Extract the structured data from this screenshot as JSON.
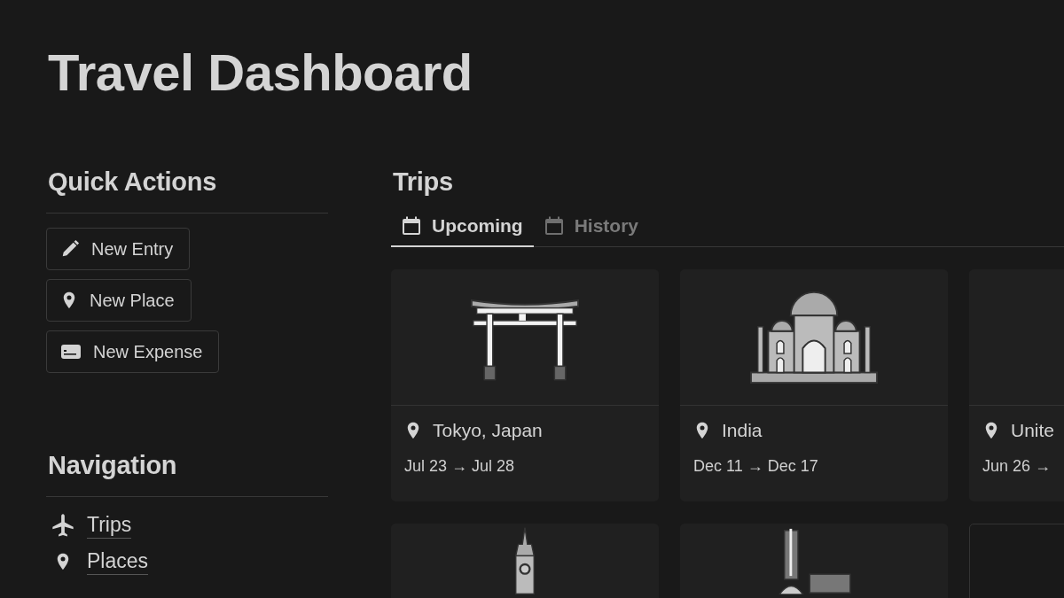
{
  "page": {
    "title": "Travel Dashboard"
  },
  "quick_actions": {
    "heading": "Quick Actions",
    "buttons": [
      {
        "kind": "pencil",
        "label": "New Entry"
      },
      {
        "kind": "pin",
        "label": "New Place"
      },
      {
        "kind": "card",
        "label": "New Expense"
      }
    ]
  },
  "navigation": {
    "heading": "Navigation",
    "links": [
      {
        "kind": "plane",
        "label": "Trips"
      },
      {
        "kind": "pin",
        "label": "Places"
      }
    ]
  },
  "trips": {
    "heading": "Trips",
    "tabs": [
      {
        "label": "Upcoming",
        "selected": true
      },
      {
        "label": "History",
        "selected": false
      }
    ],
    "cards": [
      {
        "place": "Tokyo, Japan",
        "dates": "Jul 23 → Jul 28"
      },
      {
        "place": "India",
        "dates": "Dec 11 → Dec 17"
      },
      {
        "place": "Unite",
        "dates": "Jun 26 →"
      }
    ]
  }
}
